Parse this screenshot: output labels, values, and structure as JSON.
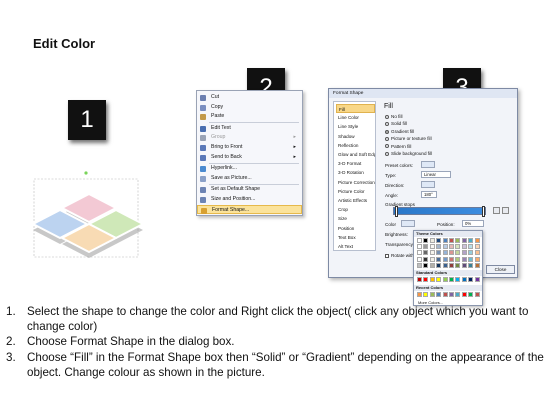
{
  "title": "Edit Color",
  "badges": [
    "1",
    "2",
    "3"
  ],
  "shape_colors": {
    "blue": "#bcd3f0",
    "pink": "#f3c9d4",
    "green": "#cfe8b8",
    "orange": "#f8dbb4"
  },
  "context_menu": {
    "items": [
      {
        "label": "Cut",
        "icon": "scissors-icon"
      },
      {
        "label": "Copy",
        "icon": "copy-icon"
      },
      {
        "label": "Paste",
        "icon": "paste-icon"
      },
      {
        "label": "Edit Text",
        "icon": "text-icon"
      },
      {
        "label": "Group",
        "icon": "group-icon"
      },
      {
        "label": "Bring to Front",
        "icon": "bring-front-icon"
      },
      {
        "label": "Send to Back",
        "icon": "send-back-icon"
      },
      {
        "label": "Hyperlink...",
        "icon": "hyperlink-icon"
      },
      {
        "label": "Save as Picture...",
        "icon": "picture-icon"
      },
      {
        "label": "Set as Default Shape",
        "icon": "default-shape-icon"
      },
      {
        "label": "Size and Position...",
        "icon": "size-icon"
      },
      {
        "label": "Format Shape...",
        "icon": "format-shape-icon"
      }
    ]
  },
  "format_dialog": {
    "title": "Format Shape",
    "nav": [
      "Fill",
      "Line Color",
      "Line Style",
      "Shadow",
      "Reflection",
      "Glow and Soft Edges",
      "3-D Format",
      "3-D Rotation",
      "Picture Corrections",
      "Picture Color",
      "Artistic Effects",
      "Crop",
      "Size",
      "Position",
      "Text Box",
      "Alt Text"
    ],
    "panel_heading": "Fill",
    "fill_options": [
      "No fill",
      "Solid fill",
      "Gradient fill",
      "Picture or texture fill",
      "Pattern fill",
      "Slide background fill"
    ],
    "preset_label": "Preset colors:",
    "type_label": "Type:",
    "type_value": "Linear",
    "direction_label": "Direction:",
    "angle_label": "Angle:",
    "angle_value": "180°",
    "stops_label": "Gradient stops",
    "color_label": "Color",
    "position_label": "Position:",
    "position_value": "0%",
    "brightness_label": "Brightness:",
    "transparency_label": "Transparency:",
    "rotate_label": "Rotate with shape",
    "close_label": "Close",
    "accent": "#2a77c8"
  },
  "palette": {
    "theme_heading": "Theme Colors",
    "standard_heading": "Standard Colors",
    "recent_heading": "Recent Colors",
    "more_label": "More Colors...",
    "theme_colors": [
      "#ffffff",
      "#000000",
      "#eeece1",
      "#1f497d",
      "#4f81bd",
      "#c0504d",
      "#9bbb59",
      "#8064a2",
      "#4bacc6",
      "#f79646"
    ],
    "standard_colors": [
      "#c00000",
      "#ff0000",
      "#ffc000",
      "#ffff00",
      "#92d050",
      "#00b050",
      "#00b0f0",
      "#0070c0",
      "#002060",
      "#7030a0"
    ],
    "recent_colors": [
      "#f79646",
      "#ffff00",
      "#9bbb59",
      "#4f81bd",
      "#c0504d",
      "#8064a2",
      "#4bacc6",
      "#ff0000",
      "#00b050",
      "#c0504d"
    ]
  },
  "steps": [
    {
      "num": "1.",
      "text": "Select the shape to change the color and Right click the object( click any object which you want to change color)"
    },
    {
      "num": "2.",
      "text": "Choose Format Shape in the dialog box."
    },
    {
      "num": "3.",
      "text": "Choose “Fill” in the Format Shape box then “Solid” or “Gradient” depending on the appearance of the object. Change colour as shown in the picture."
    }
  ]
}
